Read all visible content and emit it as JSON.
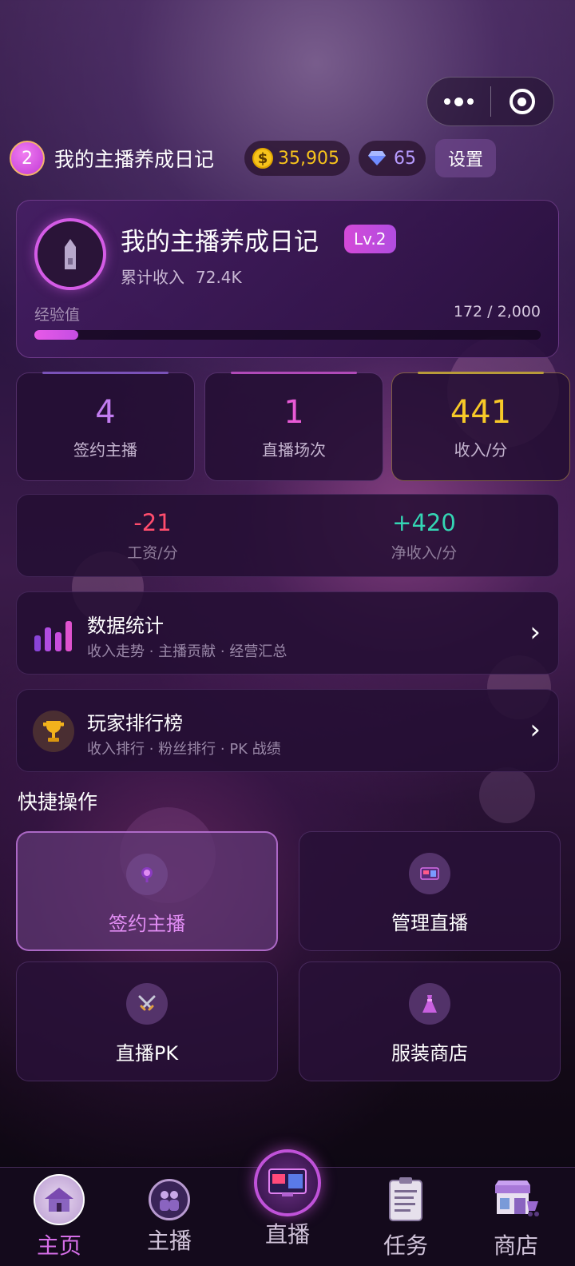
{
  "header": {
    "level": "2",
    "title": "我的主播养成日记",
    "coins": "35,905",
    "coin_symbol": "$",
    "gems": "65",
    "settings_label": "设置"
  },
  "profile": {
    "name": "我的主播养成日记",
    "level_badge": "Lv.2",
    "income_label": "累计收入",
    "income_value": "72.4K",
    "exp_label": "经验值",
    "exp_text": "172 / 2,000",
    "exp_current": 172,
    "exp_max": 2000
  },
  "stats": [
    {
      "value": "4",
      "label": "签约主播",
      "color": "#c27cf0"
    },
    {
      "value": "1",
      "label": "直播场次",
      "color": "#e85ad6"
    },
    {
      "value": "441",
      "label": "收入/分",
      "color": "#f7c928"
    }
  ],
  "wages": [
    {
      "value": "-21",
      "label": "工资/分",
      "color": "#ff4d6d"
    },
    {
      "value": "+420",
      "label": "净收入/分",
      "color": "#34d6b4"
    }
  ],
  "menu": [
    {
      "title": "数据统计",
      "subtitle": "收入走势 · 主播贡献 · 经营汇总",
      "icon": "bar-chart-icon"
    },
    {
      "title": "玩家排行榜",
      "subtitle": "收入排行 · 粉丝排行 · PK 战绩",
      "icon": "trophy-icon"
    }
  ],
  "quick_actions": {
    "title": "快捷操作",
    "items": [
      {
        "label": "签约主播",
        "icon": "microphone-icon",
        "active": true
      },
      {
        "label": "管理直播",
        "icon": "live-screen-icon",
        "active": false
      },
      {
        "label": "直播PK",
        "icon": "crossed-swords-icon",
        "active": false
      },
      {
        "label": "服装商店",
        "icon": "dress-icon",
        "active": false
      }
    ]
  },
  "tabbar": [
    {
      "label": "主页",
      "icon": "house-icon",
      "active": true
    },
    {
      "label": "主播",
      "icon": "streamers-icon",
      "active": false
    },
    {
      "label": "直播",
      "icon": "live-tv-icon",
      "active": false
    },
    {
      "label": "任务",
      "icon": "task-list-icon",
      "active": false
    },
    {
      "label": "商店",
      "icon": "shop-icon",
      "active": false
    }
  ],
  "colors": {
    "accent": "#d45be6",
    "coin": "#f7c31c",
    "gem": "#b79cff",
    "negative": "#ff4d6d",
    "positive": "#34d6b4"
  }
}
